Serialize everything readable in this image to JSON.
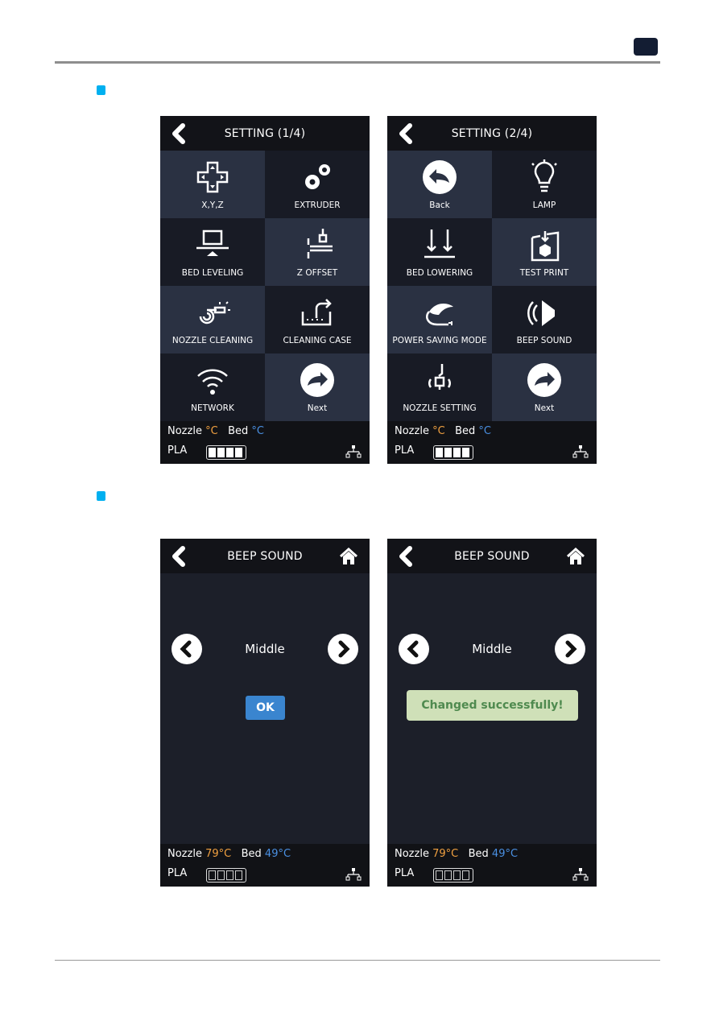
{
  "colors": {
    "accent_bullet": "#00b0f0",
    "nozzle_temp": "#f0a040",
    "bed_temp": "#4a90e2",
    "ok_button": "#3a85cf",
    "toast_bg": "#cfe0b8",
    "toast_text": "#4f8a4f"
  },
  "setting_screens": [
    {
      "title": "SETTING (1/4)",
      "tiles": [
        {
          "label": "X,Y,Z",
          "icon": "dpad-icon"
        },
        {
          "label": "EXTRUDER",
          "icon": "gears-icon"
        },
        {
          "label": "BED LEVELING",
          "icon": "bed-leveling-icon"
        },
        {
          "label": "Z OFFSET",
          "icon": "z-offset-icon"
        },
        {
          "label": "NOZZLE CLEANING",
          "icon": "nozzle-cleaning-icon"
        },
        {
          "label": "CLEANING CASE",
          "icon": "cleaning-case-icon"
        },
        {
          "label": "NETWORK",
          "icon": "wifi-icon"
        },
        {
          "label": "Next",
          "icon": "next-arrow-icon"
        }
      ],
      "footer": {
        "nozzle_label": "Nozzle",
        "nozzle_value": "°C",
        "bed_label": "Bed",
        "bed_value": "°C",
        "material": "PLA",
        "filament_level": 1.0
      }
    },
    {
      "title": "SETTING (2/4)",
      "tiles": [
        {
          "label": "Back",
          "icon": "back-arrow-icon"
        },
        {
          "label": "LAMP",
          "icon": "lamp-icon"
        },
        {
          "label": "BED LOWERING",
          "icon": "bed-lowering-icon"
        },
        {
          "label": "TEST PRINT",
          "icon": "test-print-icon"
        },
        {
          "label": "POWER SAVING MODE",
          "icon": "power-saving-icon"
        },
        {
          "label": "BEEP SOUND",
          "icon": "speaker-icon"
        },
        {
          "label": "NOZZLE SETTING",
          "icon": "nozzle-setting-icon"
        },
        {
          "label": "Next",
          "icon": "next-arrow-icon"
        }
      ],
      "footer": {
        "nozzle_label": "Nozzle",
        "nozzle_value": "°C",
        "bed_label": "Bed",
        "bed_value": "°C",
        "material": "PLA",
        "filament_level": 1.0
      }
    }
  ],
  "beep_screens": [
    {
      "title": "BEEP SOUND",
      "value": "Middle",
      "ok_label": "OK",
      "footer": {
        "nozzle_label": "Nozzle",
        "nozzle_value": "79°C",
        "bed_label": "Bed",
        "bed_value": "49°C",
        "material": "PLA",
        "filament_level": 0
      }
    },
    {
      "title": "BEEP SOUND",
      "value": "Middle",
      "toast": "Changed successfully!",
      "footer": {
        "nozzle_label": "Nozzle",
        "nozzle_value": "79°C",
        "bed_label": "Bed",
        "bed_value": "49°C",
        "material": "PLA",
        "filament_level": 0
      }
    }
  ]
}
